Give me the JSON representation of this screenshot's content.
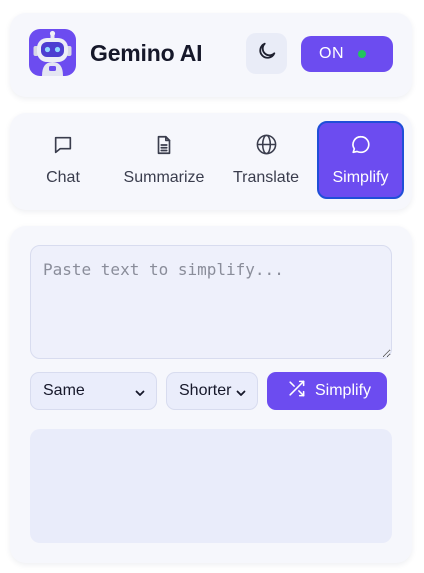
{
  "header": {
    "app_name": "Gemino AI",
    "power_label": "ON",
    "logo_icon": "robot-icon",
    "theme_icon": "moon-icon"
  },
  "tabs": [
    {
      "label": "Chat",
      "icon": "chat-bubble-icon",
      "active": false
    },
    {
      "label": "Summarize",
      "icon": "document-icon",
      "active": false
    },
    {
      "label": "Translate",
      "icon": "globe-icon",
      "active": false
    },
    {
      "label": "Simplify",
      "icon": "speech-bubble-icon",
      "active": true
    }
  ],
  "simplify": {
    "input_placeholder": "Paste text to simplify...",
    "input_value": "",
    "level_select": {
      "selected": "Same"
    },
    "length_select": {
      "selected": "Shorter"
    },
    "submit_label": "Simplify",
    "submit_icon": "shuffle-icon",
    "output_text": ""
  },
  "colors": {
    "accent": "#6c4cf0",
    "status_on": "#22c55e",
    "active_tab_border": "#1f4fd8",
    "panel_bg": "#f6f7fc"
  }
}
